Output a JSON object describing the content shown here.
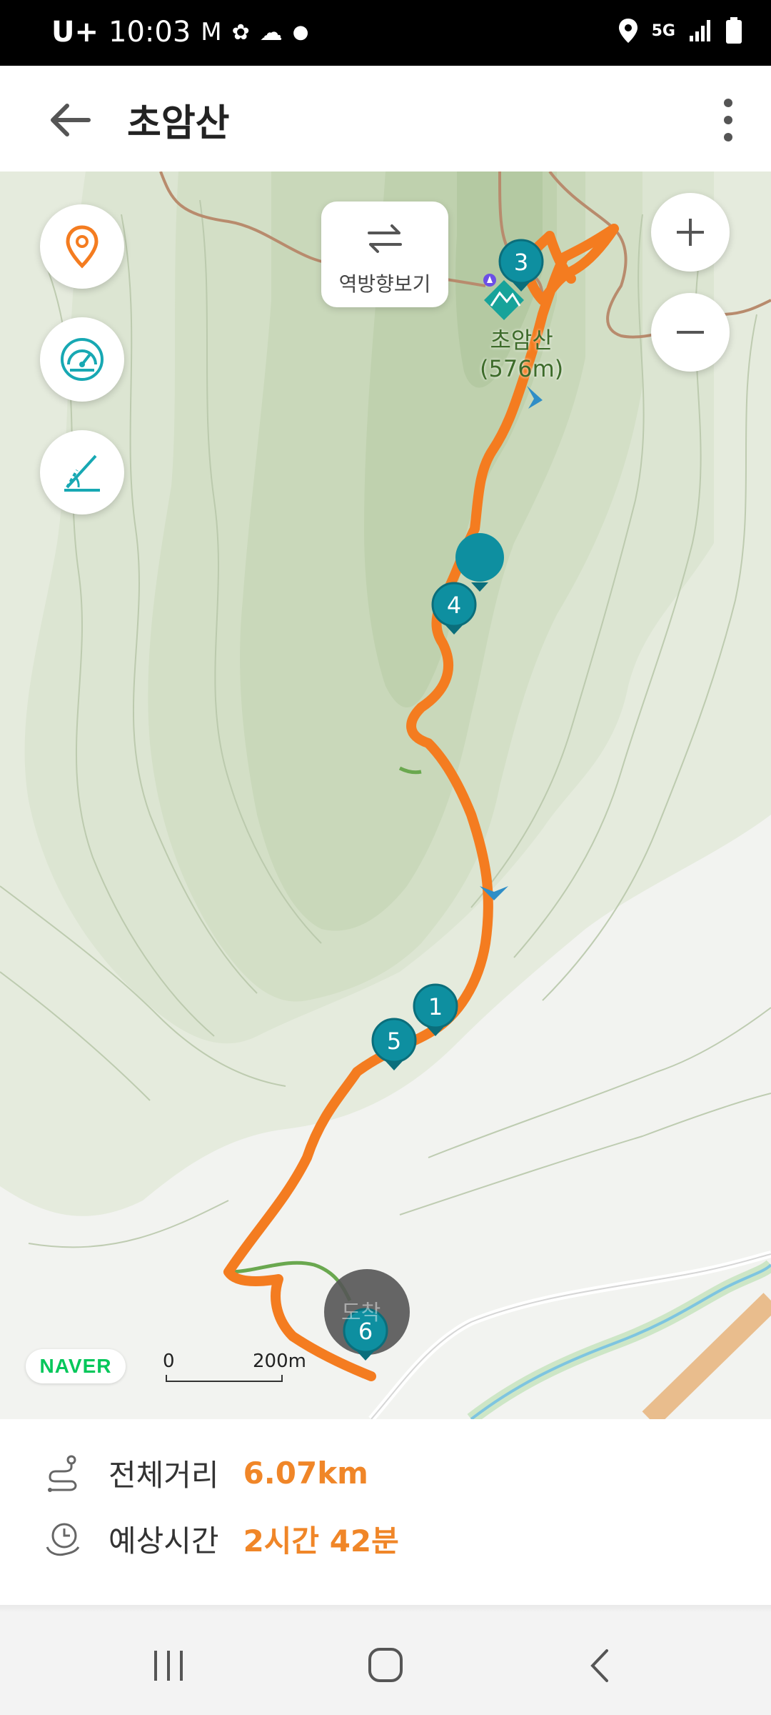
{
  "status_bar": {
    "carrier": "U+",
    "time": "10:03",
    "network": "5G"
  },
  "header": {
    "title": "초암산"
  },
  "map": {
    "reverse_button_label": "역방향보기",
    "peak_label": "초암산",
    "peak_elevation": "(576m)",
    "markers": [
      "3",
      "4",
      "1",
      "5",
      "6"
    ],
    "end_label": "도착",
    "naver_logo": "NAVER",
    "scale_start": "0",
    "scale_end": "200m",
    "route_color": "#f47c20",
    "marker_color": "#0e8fa0"
  },
  "route_info": {
    "distance_label": "전체거리",
    "distance_value": "6.07km",
    "time_label": "예상시간",
    "time_value": "2시간 42분"
  },
  "icons": {
    "back": "back-arrow-icon",
    "more": "more-vertical-icon",
    "location": "location-pin-icon",
    "speed": "speedometer-icon",
    "slope": "slope-icon",
    "swap": "swap-arrows-icon",
    "zoom_in": "plus-icon",
    "zoom_out": "minus-icon",
    "distance": "route-distance-icon",
    "time": "clock-icon"
  }
}
